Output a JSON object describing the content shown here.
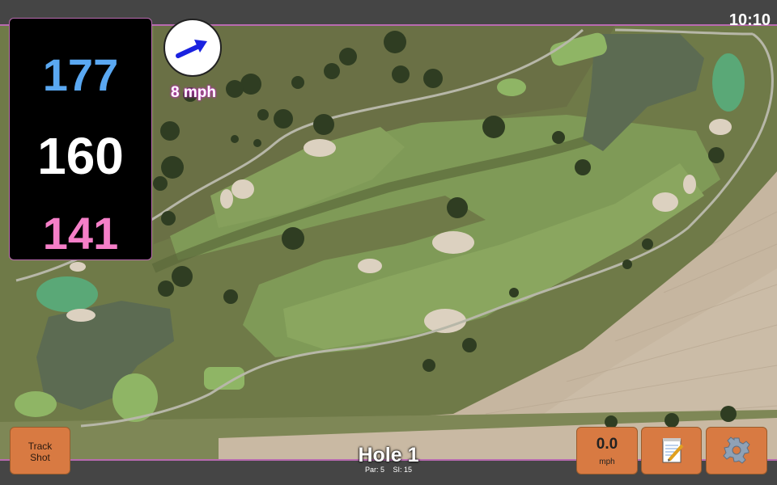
{
  "status": {
    "time": "10:10"
  },
  "distances": {
    "back": "177",
    "middle": "160",
    "front": "141"
  },
  "wind": {
    "speed": "8 mph",
    "icon": "wind-direction-arrow-icon"
  },
  "hole": {
    "title": "Hole 1",
    "par": "Par: 5",
    "si": "SI: 15"
  },
  "buttons": {
    "track_shot": [
      "Track",
      "Shot"
    ],
    "speed": {
      "value": "0.0",
      "unit": "mph"
    },
    "notes_icon": "notepad-icon",
    "settings_icon": "gear-icon"
  },
  "colors": {
    "back": "#5aa8f2",
    "middle": "#ffffff",
    "front": "#f57fc8",
    "button": "#d87a42",
    "accent": "#b86ab0"
  }
}
